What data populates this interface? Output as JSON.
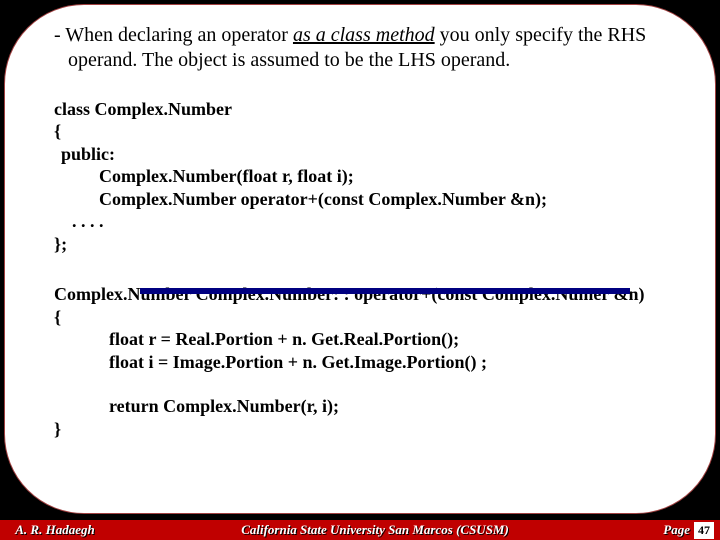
{
  "intro": {
    "prefix": "- When declaring an operator ",
    "emph": "as a class method",
    "rest": " you only specify the RHS operand. The object is assumed to be the LHS operand."
  },
  "code1": {
    "l1": "class Complex.Number",
    "l2": "{",
    "l3": "public:",
    "l4": "Complex.Number(float r, float i);",
    "l5": "Complex.Number operator+(const Complex.Number &n);",
    "l6": ". . . .",
    "l7": "};"
  },
  "code2": {
    "l1": "Complex.Number Complex.Number: : operator+(const Complex.Numer &n)",
    "l2": "{",
    "l3": "float r = Real.Portion + n. Get.Real.Portion();",
    "l4": "float i = Image.Portion + n. Get.Image.Portion() ;",
    "l5": "return Complex.Number(r, i);",
    "l6": "}"
  },
  "footer": {
    "author": "A. R. Hadaegh",
    "inst": "California State University San Marcos (CSUSM)",
    "page_word": "Page",
    "page_num": "47"
  }
}
